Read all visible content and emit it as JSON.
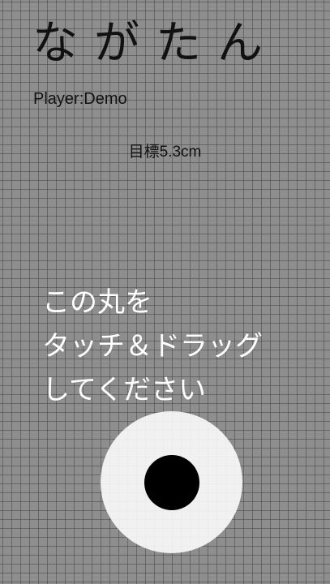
{
  "app": {
    "title": "ながたん"
  },
  "player": {
    "label": "Player:Demo"
  },
  "target": {
    "label": "目標5.3cm"
  },
  "instructions": {
    "lines": [
      "この丸を",
      "タッチ＆ドラッグ",
      "してください"
    ]
  },
  "colors": {
    "background": "#8e8e8e",
    "grid_line": "#464646",
    "circle_outer": "#ffffff",
    "circle_center": "#000000",
    "instruction_text": "#ffffff",
    "label_text": "#111111"
  }
}
